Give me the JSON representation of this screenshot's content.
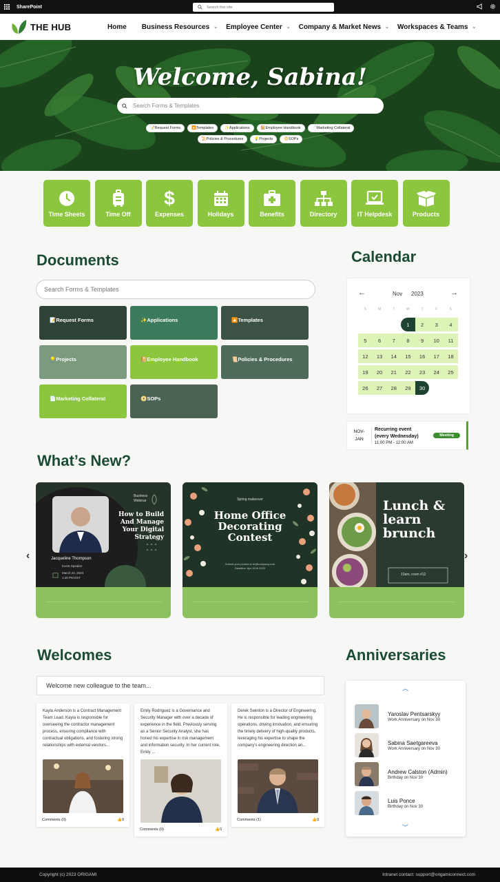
{
  "suite_bar": {
    "app_name": "SharePoint",
    "search_placeholder": "Search this site"
  },
  "header": {
    "logo_text": "THE HUB",
    "nav": [
      {
        "label": "Home",
        "has_dropdown": false
      },
      {
        "label": "Business Resources",
        "has_dropdown": true
      },
      {
        "label": "Employee Center",
        "has_dropdown": true
      },
      {
        "label": "Company & Market News",
        "has_dropdown": true
      },
      {
        "label": "Workspaces & Teams",
        "has_dropdown": true
      }
    ]
  },
  "hero": {
    "greeting": "Welcome, Sabina!",
    "search_placeholder": "Search Forms & Templates",
    "chips_row1": [
      "📝Request Forms",
      "🔼Templates",
      "✨Applications",
      "📔Employee Handbook",
      "📄Marketing Collateral"
    ],
    "chips_row2": [
      "📜Policies & Procedures",
      "💡Projects",
      "📀SOPs"
    ]
  },
  "quick_links": [
    {
      "label": "Time Sheets",
      "icon": "clock-icon"
    },
    {
      "label": "Time Off",
      "icon": "luggage-icon"
    },
    {
      "label": "Expenses",
      "icon": "dollar-icon"
    },
    {
      "label": "Holidays",
      "icon": "calendar-icon"
    },
    {
      "label": "Benefits",
      "icon": "medkit-icon"
    },
    {
      "label": "Directory",
      "icon": "sitemap-icon"
    },
    {
      "label": "IT Helpdesk",
      "icon": "laptop-icon"
    },
    {
      "label": "Products",
      "icon": "box-icon"
    }
  ],
  "documents": {
    "title": "Documents",
    "search_placeholder": "Search Forms & Templates",
    "tiles": [
      {
        "label": "📝Request Forms",
        "color": "#2e4236"
      },
      {
        "label": "✨Applications",
        "color": "#3b7a5b"
      },
      {
        "label": "🔼Templates",
        "color": "#3b5244"
      },
      {
        "label": "💡Projects",
        "color": "#7b9a80"
      },
      {
        "label": "📔Employee Handbook",
        "color": "#8cc63f"
      },
      {
        "label": "📜Policies & Procedures",
        "color": "#4f6b59"
      },
      {
        "label": "📄Marketing Collateral",
        "color": "#8cc63f"
      },
      {
        "label": "📀SOPs",
        "color": "#4a6353"
      }
    ]
  },
  "calendar": {
    "title": "Calendar",
    "month": "Nov",
    "year": "2023",
    "weekdays": [
      "S",
      "M",
      "T",
      "W",
      "T",
      "F",
      "S"
    ],
    "event": {
      "date": "NOV-JAN",
      "date_line1": "NOV-",
      "date_line2": "JAN",
      "title": "Recurring event (every Wednesday)",
      "time": "11:00 PM - 12:00 AM",
      "badge": "Meeting"
    }
  },
  "whats_new": {
    "title": "What’s New?",
    "cards": [
      {
        "tag": "Business Webinar",
        "headline": "How to Build And Manage Your Digital Strategy",
        "speaker": "Jacqueline Thompson",
        "role": "Event Speaker",
        "date": "March 22, 2024",
        "time": "1:30 PM EST"
      },
      {
        "tag": "Spring makeover",
        "headline": "Home Office Decorating Contest",
        "note": "Submit your photos to hr@company.com",
        "deadline": "Deadline: Apr 18 th 2023"
      },
      {
        "headline": "Lunch & learn brunch",
        "note": "10am, room #12"
      }
    ]
  },
  "welcomes": {
    "title": "Welcomes",
    "input_text": "Welcome new colleague to the team...",
    "cards": [
      {
        "text": "Kayla Anderson is a Contract Management Team Lead. Kayla is responsible for overseeing the contractor management process, ensuring compliance with contractual obligations, and fostering strong relationships with external vendors...",
        "comments": "Comments (0)",
        "likes": "0"
      },
      {
        "text": "Emily Rodriguez is a Governance and Security Manager with over a decade of experience in the field. Previously serving as a Senior Security Analyst, she has honed his expertise in risk management and information security. In her current role, Emily ...",
        "comments": "Comments (0)",
        "likes": "0"
      },
      {
        "text": "Derek Swinton is a Director of Engineering. He is responsible for leading engineering operations, driving innovation, and ensuring the timely delivery of high-quality products, leveraging his expertise to shape the company's engineering direction an...",
        "comments": "Comments (1)",
        "likes": "0"
      }
    ]
  },
  "anniversaries": {
    "title": "Anniversaries",
    "items": [
      {
        "name": "Yaroslav Pentsarskyy",
        "sub": "Work Anniversary on Nov 30"
      },
      {
        "name": "Sabina Saetgareeva",
        "sub": "Work Anniversary on Nov 30"
      },
      {
        "name": "Andrew Calston (Admin)",
        "sub": "Birthday on Nov 30"
      },
      {
        "name": "Luis Ponce",
        "sub": "Birthday on Nov 30"
      }
    ]
  },
  "footer": {
    "copyright": "Copyright (c) 2023 ORIGAMI",
    "contact": "Intranet contact: support@origamiconnect.com"
  },
  "colors": {
    "accent_green": "#8cc63f",
    "dark_green": "#1b4a35",
    "footer_bg": "#0e0e0e"
  }
}
